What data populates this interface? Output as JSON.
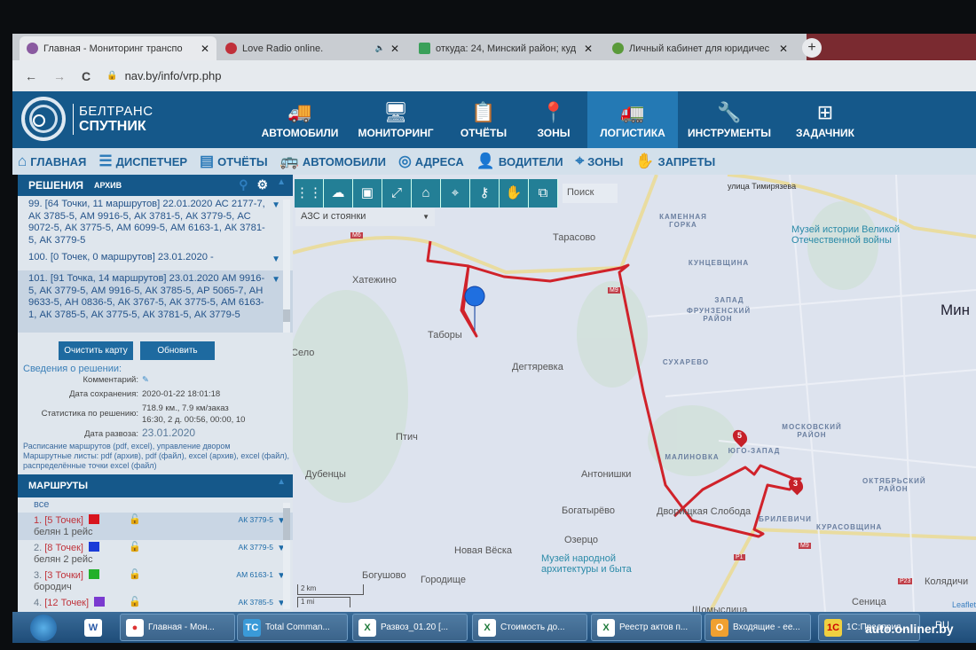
{
  "browser": {
    "tabs": [
      {
        "label": "Главная - Мониторинг транспо",
        "close": "✕",
        "favicon": "#8a5aa0"
      },
      {
        "label": "Love Radio online.",
        "close": "✕",
        "audio": "🔈",
        "favicon": "#c0303a"
      },
      {
        "label": "откуда: 24, Минский район; куд",
        "close": "✕",
        "favicon": "#3aa05a"
      },
      {
        "label": "Личный кабинет для юридичес",
        "close": "✕",
        "favicon": "#5a9a3a"
      }
    ],
    "new_tab": "+",
    "back": "←",
    "forward": "→",
    "reload": "C",
    "lock": "🔒",
    "url": "nav.by/info/vrp.php"
  },
  "logo": {
    "line1": "БЕЛТРАНС",
    "line2": "СПУТНИК"
  },
  "main_nav": [
    {
      "label": "АВТОМОБИЛИ",
      "icon": "🚚"
    },
    {
      "label": "МОНИТОРИНГ",
      "icon": "🖥"
    },
    {
      "label": "ОТЧЁТЫ",
      "icon": "📋"
    },
    {
      "label": "ЗОНЫ",
      "icon": "📍"
    },
    {
      "label": "ЛОГИСТИКА",
      "icon": "🚛"
    },
    {
      "label": "ИНСТРУМЕНТЫ",
      "icon": "🔧"
    },
    {
      "label": "ЗАДАЧНИК",
      "icon": "⊞"
    }
  ],
  "sub_nav": [
    {
      "label": "ГЛАВНАЯ",
      "icon": "⌂"
    },
    {
      "label": "ДИСПЕТЧЕР",
      "icon": "☰"
    },
    {
      "label": "ОТЧЁТЫ",
      "icon": "▤"
    },
    {
      "label": "АВТОМОБИЛИ",
      "icon": "🚌"
    },
    {
      "label": "АДРЕСА",
      "icon": "◎"
    },
    {
      "label": "ВОДИТЕЛИ",
      "icon": "👤"
    },
    {
      "label": "ЗОНЫ",
      "icon": "⌖"
    },
    {
      "label": "ЗАПРЕТЫ",
      "icon": "✋"
    }
  ],
  "solutions": {
    "tab_active": "РЕШЕНИЯ",
    "tab_archive": "АРХИВ",
    "items": [
      {
        "text": "99. [64 Точки, 11 маршрутов] 22.01.2020 АС 2177-7, АК 3785-5, АМ 9916-5, АК 3781-5, АК 3779-5, АС 9072-5, АК 3775-5, АМ 6099-5, АМ 6163-1, АК 3781-5, АК 3779-5"
      },
      {
        "text": "100. [0 Точек, 0 маршрутов] 23.01.2020 -"
      },
      {
        "text": "101. [91 Точка, 14 маршрутов] 23.01.2020 АМ 9916-5, АК 3779-5, АМ 9916-5, АК 3785-5, АР 5065-7, АН 9633-5, АН 0836-5, АК 3767-5, АК 3775-5, АМ 6163-1, АК 3785-5, АК 3775-5, АК 3781-5, АК 3779-5"
      }
    ],
    "clear_button": "Очистить карту",
    "refresh_button": "Обновить"
  },
  "details": {
    "title": "Сведения о решении:",
    "comment_label": "Комментарий:",
    "saved_label": "Дата сохранения:",
    "saved_value": "2020-01-22 18:01:18",
    "stats_label": "Статистика по решению:",
    "stats_line1": "718.9 км., 7.9 км/заказ",
    "stats_line2": "16:30, 2 д. 00:56, 00:00, 10",
    "delivery_label": "Дата развоза:",
    "delivery_value": "23.01.2020",
    "links1": "Расписание маршрутов (pdf, excel), управление двором",
    "links2": "Маршрутные листы: pdf (архив), pdf (файл), excel (архив), excel (файл), распределённые точки excel (файл)"
  },
  "routes": {
    "title": "МАРШРУТЫ",
    "all": "все",
    "items": [
      {
        "num": "1.",
        "points": "[5 Точек]",
        "color": "#d8141e",
        "name": "белян 1 рейс",
        "car": "АК 3779-5"
      },
      {
        "num": "2.",
        "points": "[8 Точек]",
        "color": "#1a3bd8",
        "name": "белян 2 рейс",
        "car": "АК 3779-5"
      },
      {
        "num": "3.",
        "points": "[3 Точки]",
        "color": "#22b02a",
        "name": "бородич",
        "car": "АМ 6163-1"
      },
      {
        "num": "4.",
        "points": "[12 Точек]",
        "color": "#7a3ad0",
        "name": "",
        "car": "АК 3785-5"
      }
    ]
  },
  "map": {
    "search_placeholder": "Поиск",
    "layer_select": "АЗС и стоянки",
    "route_color": "#d0222a",
    "labels": {
      "tarasovo": "Тарасово",
      "khatezhino": "Хатежино",
      "tabory": "Таборы",
      "selo": "Село",
      "degtyarevka": "Дегтяревка",
      "ptich": "Птич",
      "dubentsy": "Дубенцы",
      "antonishki": "Антонишки",
      "bogatyrevo": "Богатырёво",
      "dvorishche": "Дворищкая Слобода",
      "ozertso": "Озерцо",
      "novaya_veska": "Новая Вёска",
      "bogushovo": "Богушово",
      "gorodishche": "Городище",
      "museum_folk": "Музей народной архитектуры и быта",
      "museum_war": "Музей истории Великой Отечественной войны",
      "timiryazeva": "улица Тимирязева",
      "minsk": "Мин",
      "kolyadichi": "Колядичи",
      "senitsa": "Сеница",
      "shchomyslitsa": "Щомыслица",
      "kamennaya_gorka": "КАМЕННАЯ ГОРКА",
      "kuntsevshchina": "КУНЦЕВЩИНА",
      "zapad": "ЗАПАД",
      "frunzensky": "ФРУНЗЕНСКИЙ РАЙОН",
      "sukharevo": "СУХАРЕВО",
      "moskovsky": "МОСКОВСКИЙ РАЙОН",
      "yugo_zapad": "ЮГО-ЗАПАД",
      "malinovka": "МАЛИНОВКА",
      "oktyabrsky": "ОКТЯБРЬСКИЙ РАЙОН",
      "kurasovshchina": "КУРАСОВЩИНА",
      "brilevichi": "БРИЛЕВИЧИ"
    },
    "roads": {
      "m6": "M6",
      "m9": "M9",
      "p1": "P1",
      "p23": "P23"
    },
    "markers": [
      "5",
      "3"
    ],
    "scale_km": "2 km",
    "scale_mi": "1 mi",
    "attribution": "Leaflet"
  },
  "taskbar": {
    "items": [
      "Главная - Мон...",
      "Total Comman...",
      "Развоз_01.20  [...",
      "Стоимость до...",
      "Реестр актов п...",
      "Входящие - ее...",
      "1С:Предприя..."
    ],
    "lang": "RU"
  },
  "watermark": "auto.onliner.by"
}
